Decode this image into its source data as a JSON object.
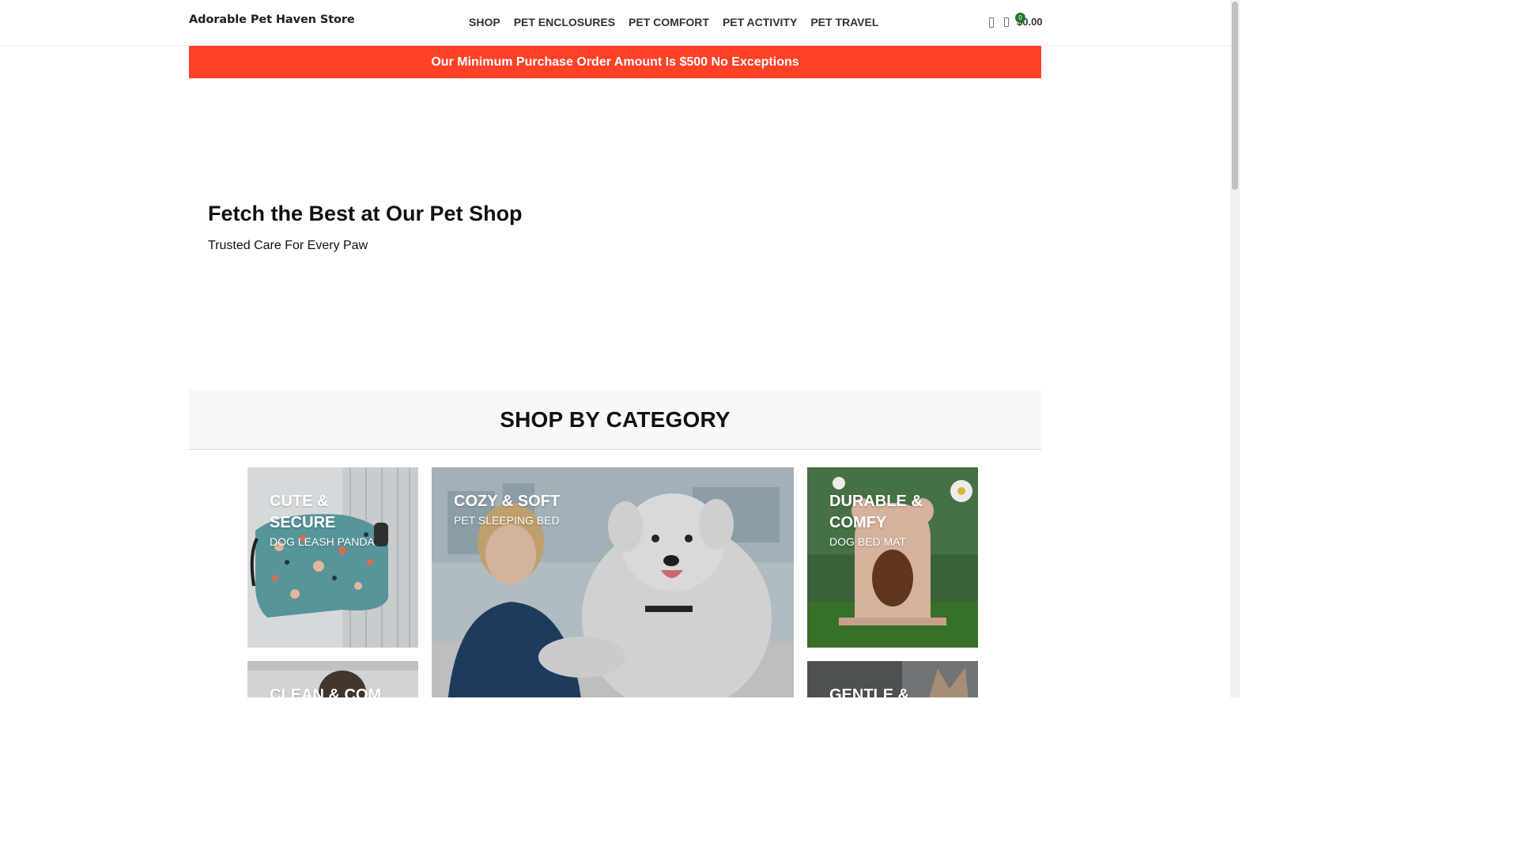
{
  "header": {
    "logo": "Adorable Pet Haven Store",
    "nav": [
      "SHOP",
      "PET ENCLOSURES",
      "PET COMFORT",
      "PET ACTIVITY",
      "PET TRAVEL"
    ],
    "cart_count": "0",
    "cart_total": "$0.00"
  },
  "announcement": "Our Minimum Purchase Order Amount Is $500 No Exceptions",
  "hero": {
    "title": "Fetch the Best at Our Pet Shop",
    "subtitle": "Trusted Care For Every Paw"
  },
  "categories": {
    "heading": "SHOP BY CATEGORY",
    "tiles": [
      {
        "title": "CUTE & SECURE",
        "subtitle": "DOG LEASH PANDA"
      },
      {
        "title": "COZY & SOFT",
        "subtitle": "PET SLEEPING BED"
      },
      {
        "title": "DURABLE & COMFY",
        "subtitle": "DOG BED MAT"
      },
      {
        "title": "CLEAN & COM",
        "subtitle": ""
      },
      {
        "title": "GENTLE &",
        "subtitle": ""
      }
    ]
  },
  "colors": {
    "announcement_bg": "#fe4127",
    "cart_badge": "#1d7a2a"
  }
}
